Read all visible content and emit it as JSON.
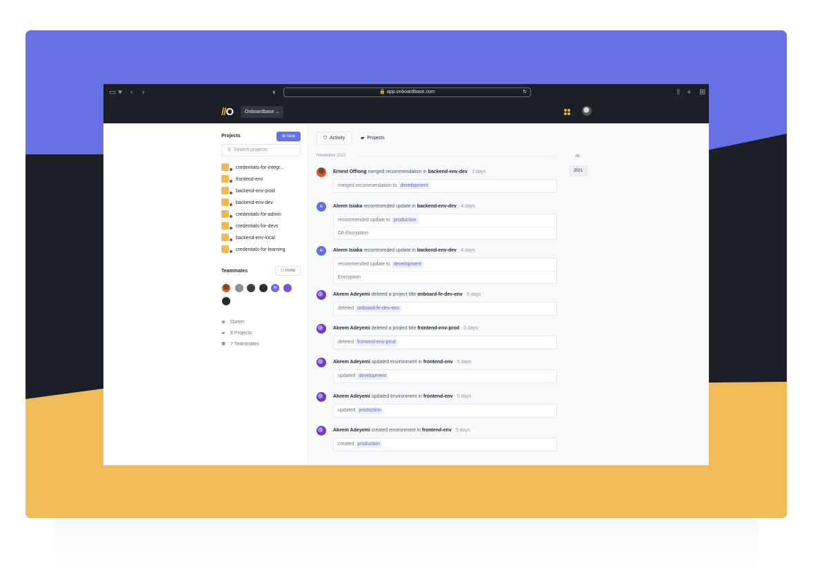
{
  "browser": {
    "url": "app.onboardbase.com"
  },
  "app": {
    "logo_text": "//O",
    "org_name": "Onboardbase"
  },
  "sidebar": {
    "projects_heading": "Projects",
    "new_label": "New",
    "search_placeholder": "Search projects",
    "projects": [
      "credentials-for-integr...",
      "frontend-env",
      "backend-env-prod",
      "backend-env-dev",
      "credentials-for-admin",
      "credentials-for-devs",
      "backend-env-local",
      "credentials-for-learning"
    ],
    "teammates_heading": "Teammates",
    "invite_label": "Invite",
    "teammate_initials": "AI",
    "owner": "Owner",
    "project_count": "8 Projects",
    "teammate_count": "7 Teammates"
  },
  "main": {
    "tabs": [
      "Activity",
      "Projects"
    ],
    "month": "November 2021",
    "years": [
      "All",
      "2021"
    ],
    "activities": [
      {
        "initials": "",
        "actor": "Ernest Offiong",
        "action": "merged recommendation in",
        "target": "backend-env-dev",
        "time": "2 days",
        "detail_text": "merged recommendation to",
        "detail_chip": "development",
        "sub": ""
      },
      {
        "initials": "AI",
        "actor": "Aleem Isiaka",
        "action": "recommended update in",
        "target": "backend-env-dev",
        "time": "4 days",
        "detail_text": "recommended update to",
        "detail_chip": "production",
        "sub": "Db Encryption"
      },
      {
        "initials": "AI",
        "actor": "Aleem Isiaka",
        "action": "recommended update in",
        "target": "backend-env-dev",
        "time": "4 days",
        "detail_text": "recommended update to",
        "detail_chip": "development",
        "sub": "Encryption"
      },
      {
        "initials": "",
        "actor": "Akeem Adeyemi",
        "action": "deleted a project title",
        "target": "onboard-fe-dev-env",
        "time": "5 days",
        "detail_text": "deleted",
        "detail_chip": "onboard-fe-dev-env",
        "sub": ""
      },
      {
        "initials": "",
        "actor": "Akeem Adeyemi",
        "action": "deleted a project title",
        "target": "frontend-env-prod",
        "time": "5 days",
        "detail_text": "deleted",
        "detail_chip": "frontend-env-prod",
        "sub": ""
      },
      {
        "initials": "",
        "actor": "Akeem Adeyemi",
        "action": "updated environment in",
        "target": "frontend-env",
        "time": "5 days",
        "detail_text": "updated",
        "detail_chip": "development",
        "sub": ""
      },
      {
        "initials": "",
        "actor": "Akeem Adeyemi",
        "action": "updated environment in",
        "target": "frontend-env",
        "time": "5 days",
        "detail_text": "updated",
        "detail_chip": "production",
        "sub": ""
      },
      {
        "initials": "",
        "actor": "Akeem Adeyemi",
        "action": "created environment in",
        "target": "frontend-env",
        "time": "5 days",
        "detail_text": "created",
        "detail_chip": "production",
        "sub": ""
      }
    ]
  },
  "colors": {
    "accent": "#6370e8",
    "backdrop_top": "#6771e4",
    "backdrop_mid": "#1c1f26",
    "backdrop_bottom": "#f1bb57",
    "project_icon": "#f5b84a"
  }
}
